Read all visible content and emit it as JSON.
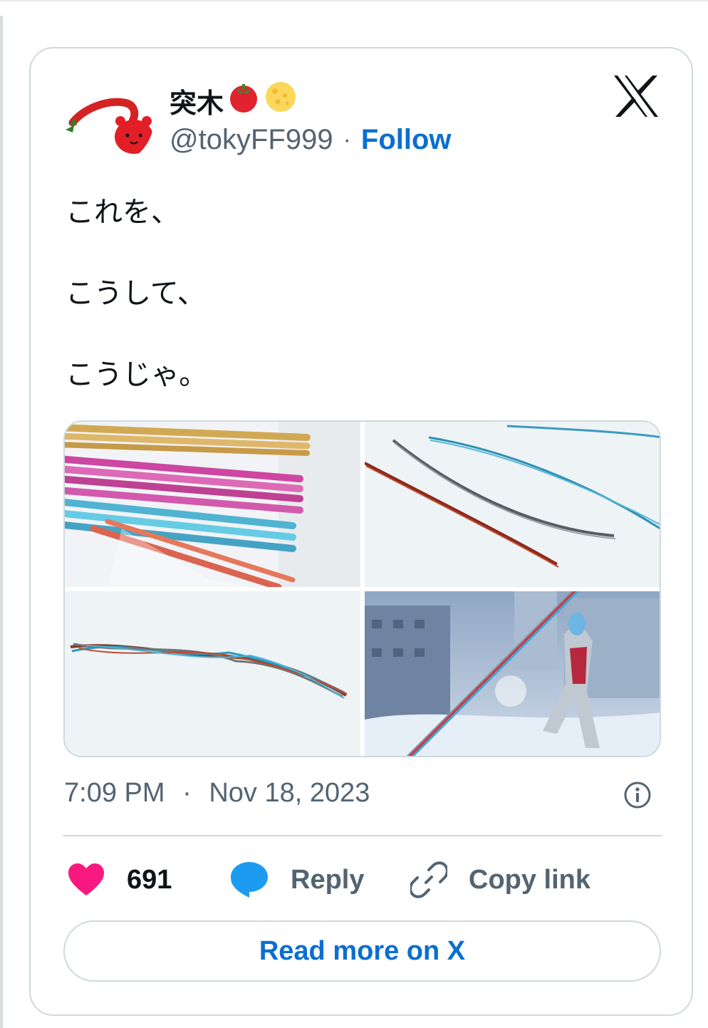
{
  "author": {
    "display_name": "突木",
    "name_emojis": [
      "tomato-emoji",
      "cheese-emoji"
    ],
    "handle": "@tokyFF999",
    "separator": "·",
    "follow_label": "Follow"
  },
  "tweet": {
    "lines": [
      "これを、",
      "こうして、",
      "こうじゃ。"
    ]
  },
  "media": {
    "images": [
      "colored-foil-straws-photo",
      "twisted-wires-photo",
      "braided-wire-strand-photo",
      "hero-with-wire-spear-illustration"
    ]
  },
  "meta": {
    "time": "7:09 PM",
    "separator": "·",
    "date": "Nov 18, 2023"
  },
  "actions": {
    "likes_count": "691",
    "reply_label": "Reply",
    "copy_link_label": "Copy link"
  },
  "read_more_label": "Read more on X",
  "colors": {
    "accent": "#0a6fd0",
    "heart": "#f91880",
    "reply_bubble": "#1d9bf0",
    "muted": "#536471",
    "border": "#cfd9de"
  },
  "icons": [
    "x-logo-icon",
    "heart-icon",
    "reply-bubble-icon",
    "link-icon",
    "info-icon"
  ]
}
